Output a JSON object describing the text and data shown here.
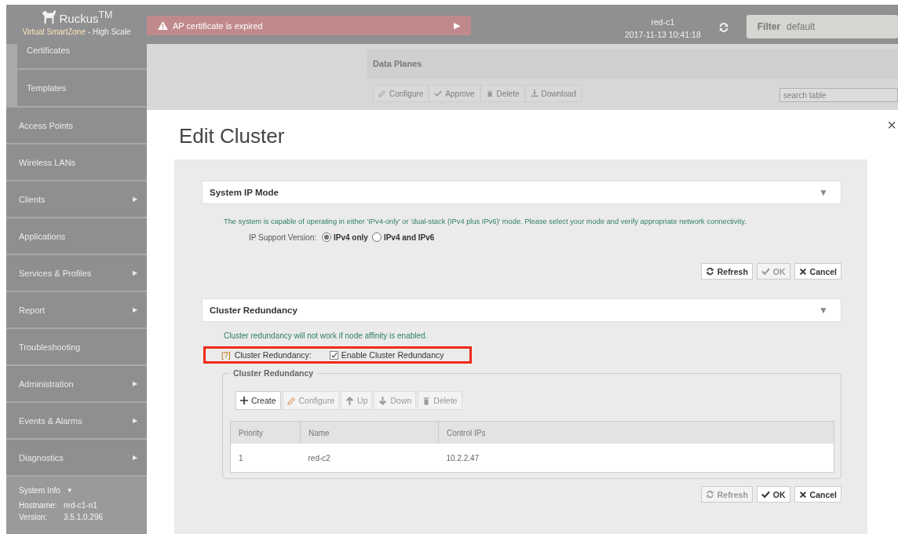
{
  "header": {
    "brand": "Ruckus$^{TM}$",
    "product": "Virtual SmartZone",
    "edition": "- High Scale",
    "alert": {
      "text": "AP certificate is expired",
      "arrow": "▶"
    },
    "controller": {
      "name": "red-c1",
      "datetime": "2017-11-13 10:41:18"
    },
    "filter": {
      "label": "Filter",
      "value": "default"
    }
  },
  "sidebar": {
    "items": [
      {
        "label": "Certificates",
        "kind": "sub"
      },
      {
        "label": "Templates",
        "kind": "sub"
      },
      {
        "label": "Access Points",
        "kind": "main"
      },
      {
        "label": "Wireless LANs",
        "kind": "main"
      },
      {
        "label": "Clients",
        "kind": "main",
        "arrow": "▶"
      },
      {
        "label": "Applications",
        "kind": "main"
      },
      {
        "label": "Services & Profiles",
        "kind": "main",
        "arrow": "▶"
      },
      {
        "label": "Report",
        "kind": "main",
        "arrow": "▶"
      },
      {
        "label": "Troubleshooting",
        "kind": "main"
      },
      {
        "label": "Administration",
        "kind": "main",
        "arrow": "▶"
      },
      {
        "label": "Events & Alarms",
        "kind": "main",
        "arrow": "▶"
      },
      {
        "label": "Diagnostics",
        "kind": "main",
        "arrow": "▶"
      }
    ],
    "system_info": {
      "title": "System Info",
      "caret": "▼",
      "rows": [
        {
          "label": "Hostname:",
          "value": "red-c1-n1"
        },
        {
          "label": "Version:",
          "value": "3.5.1.0.296"
        }
      ]
    }
  },
  "background": {
    "title": "Data Planes",
    "toolbar": [
      {
        "label": "Configure",
        "kind": "configure"
      },
      {
        "label": "Approve",
        "kind": "ok"
      },
      {
        "label": "Delete",
        "kind": "delete"
      },
      {
        "label": "Download",
        "kind": "download"
      }
    ],
    "search": {
      "placeholder": "search table"
    }
  },
  "dialog": {
    "title": "Edit Cluster",
    "close": "×",
    "ip_mode": {
      "title": "System IP Mode",
      "caret": "▼",
      "description": "The system is capable of operating in either 'IPv4-only' or 'dual-stack (IPv4 plus IPv6)' mode. Please select your mode and verify appropriate network connectivity.",
      "ip_support": {
        "label": "IP Support Version:",
        "options": [
          {
            "label": "IPv4 only",
            "selected": true
          },
          {
            "label": "IPv4 and IPv6",
            "selected": false
          }
        ]
      },
      "buttons": [
        {
          "label": "Refresh",
          "kind": "refresh",
          "disabled": false
        },
        {
          "label": "OK",
          "kind": "ok",
          "disabled": true
        },
        {
          "label": "Cancel",
          "kind": "cancel",
          "disabled": false
        }
      ]
    },
    "cluster_redundancy": {
      "title": "Cluster Redundancy",
      "caret": "▼",
      "note": "Cluster redundancy will not work if node affinity is enabled.",
      "setting": {
        "highlighted": true,
        "help": "[?]",
        "label": "Cluster Redundancy:",
        "checkbox": {
          "label": "Enable Cluster Redundancy",
          "checked": true
        }
      },
      "group": {
        "legend": "Cluster Redundancy",
        "toolbar": [
          {
            "label": "Create",
            "kind": "create",
            "disabled": false
          },
          {
            "label": "Configure",
            "kind": "configure",
            "disabled": true
          },
          {
            "label": "Up",
            "kind": "up",
            "disabled": true
          },
          {
            "label": "Down",
            "kind": "down",
            "disabled": true
          },
          {
            "label": "Delete",
            "kind": "delete",
            "disabled": true
          }
        ],
        "table": {
          "columns": [
            "Priority",
            "Name",
            "Control IPs"
          ],
          "rows": [
            [
              "1",
              "red-c2",
              "10.2.2.47"
            ]
          ]
        }
      },
      "buttons": [
        {
          "label": "Refresh",
          "kind": "refresh",
          "disabled": true
        },
        {
          "label": "OK",
          "kind": "ok",
          "disabled": false
        },
        {
          "label": "Cancel",
          "kind": "cancel",
          "disabled": false
        }
      ]
    }
  }
}
